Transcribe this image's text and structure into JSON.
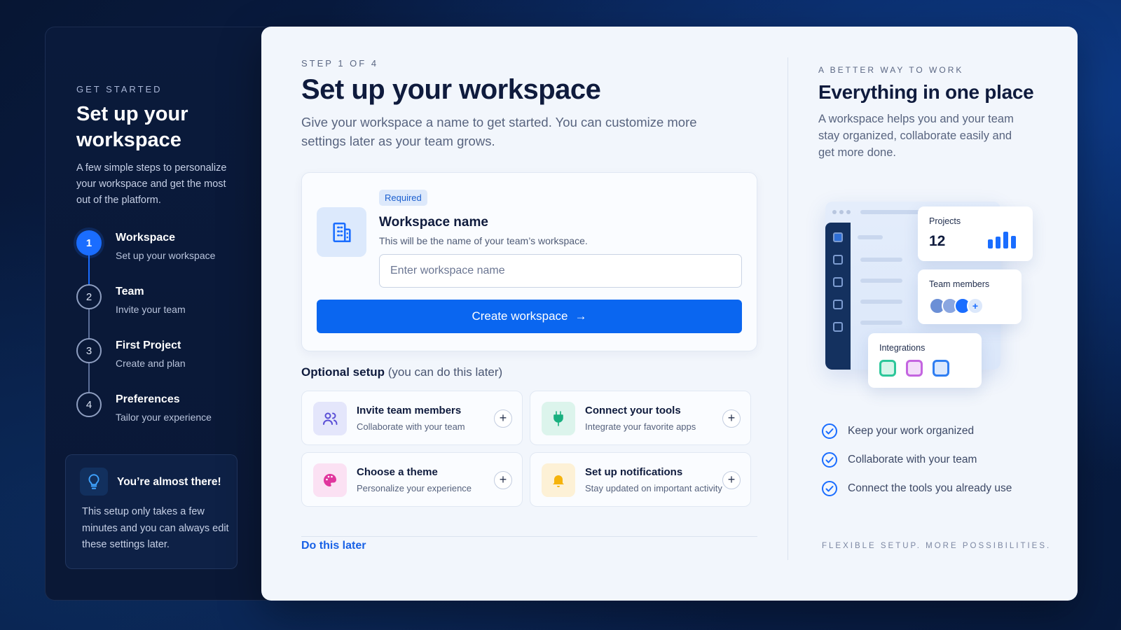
{
  "sidebar": {
    "eyebrow": "GET STARTED",
    "title": "Set up your workspace",
    "description": "A few simple steps to personalize your workspace and get the most out of the platform.",
    "steps": [
      {
        "num": "1",
        "title": "Workspace",
        "subtitle": "Set up your workspace",
        "active": true
      },
      {
        "num": "2",
        "title": "Team",
        "subtitle": "Invite your team",
        "active": false
      },
      {
        "num": "3",
        "title": "First Project",
        "subtitle": "Create and plan",
        "active": false
      },
      {
        "num": "4",
        "title": "Preferences",
        "subtitle": "Tailor your experience",
        "active": false
      }
    ],
    "tip": {
      "icon": "lightbulb-icon",
      "title": "You’re almost there!",
      "body": "This setup only takes a few minutes and you can always edit these settings later."
    }
  },
  "main": {
    "eyebrow": "STEP 1 OF 4",
    "title": "Set up your workspace",
    "description": "Give your workspace a name to get started. You can customize more settings later as your team grows.",
    "card": {
      "badge": "Required",
      "label": "Workspace name",
      "help": "This will be the name of your team’s workspace.",
      "input_value": "",
      "input_placeholder": "Enter workspace name",
      "button_label": "Create workspace",
      "button_arrow": "→"
    },
    "optional": {
      "heading": "Optional setup",
      "heading_note": "(you can do this later)",
      "items": [
        {
          "title": "Invite team members",
          "subtitle": "Collaborate with your team",
          "icon": "users-icon",
          "color": "#e4e6fb"
        },
        {
          "title": "Connect your tools",
          "subtitle": "Integrate your favorite apps",
          "icon": "plug-icon",
          "color": "#dcf4ec"
        },
        {
          "title": "Choose a theme",
          "subtitle": "Personalize your experience",
          "icon": "palette-icon",
          "color": "#fbe1f3"
        },
        {
          "title": "Set up notifications",
          "subtitle": "Stay updated on important activity",
          "icon": "bell-icon",
          "color": "#fdf1d6"
        }
      ],
      "plus": "+"
    },
    "later_link": "Do this later"
  },
  "right": {
    "eyebrow": "A BETTER WAY TO WORK",
    "title": "Everything in one place",
    "description": "A workspace helps you and your team stay organized, collaborate easily and get more done.",
    "illustration": {
      "projects_label": "Projects",
      "projects_value": "12",
      "projects_bars": [
        0.45,
        0.6,
        0.85,
        0.65
      ],
      "team_label": "Team members",
      "integrations_label": "Integrations",
      "avatar_colors": [
        "#6b8fd6",
        "#8aa6e0",
        "#1a6dff"
      ],
      "integration_colors": [
        "#2cc79a",
        "#c465e0",
        "#2f7ef2"
      ]
    },
    "checks": [
      "Keep your work organized",
      "Collaborate with your team",
      "Connect the tools you already use"
    ],
    "tagline": "FLEXIBLE SETUP. MORE POSSIBILITIES."
  },
  "colors": {
    "accent": "#0a66f0",
    "sidebar_bg": "#0a1a3b",
    "panel_bg": "#f2f6fc"
  }
}
